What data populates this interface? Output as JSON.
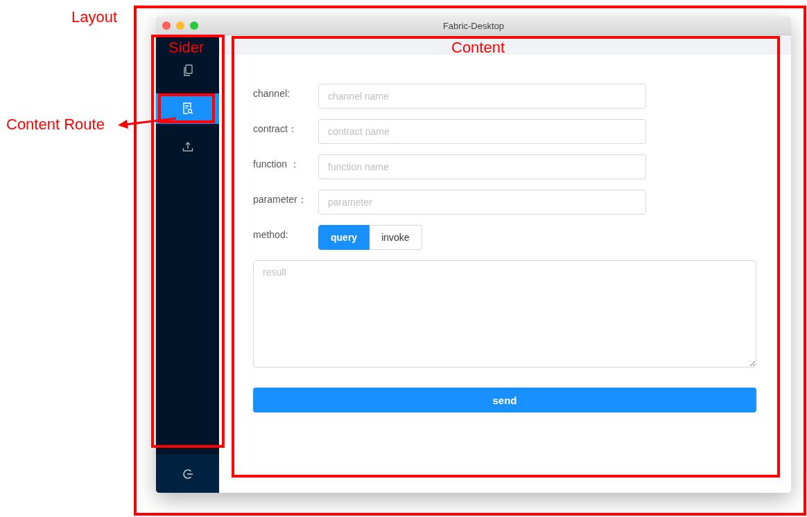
{
  "window": {
    "title": "Fabric-Desktop"
  },
  "sider": {
    "items": [
      {
        "kind": "copy",
        "selected": false
      },
      {
        "kind": "search-doc",
        "selected": true
      },
      {
        "kind": "upload",
        "selected": false
      }
    ],
    "footer": {
      "kind": "logout"
    }
  },
  "form": {
    "fields": [
      {
        "label": "channel:",
        "placeholder": "channel name"
      },
      {
        "label": "contract：",
        "placeholder": "contract name"
      },
      {
        "label": "function ：",
        "placeholder": "function name"
      },
      {
        "label": "parameter：",
        "placeholder": "parameter"
      }
    ],
    "method": {
      "label": "method:",
      "options": [
        {
          "label": "query",
          "selected": true
        },
        {
          "label": "invoke",
          "selected": false
        }
      ]
    },
    "result": {
      "placeholder": "result"
    },
    "send_button": "send"
  },
  "annotations": [
    {
      "label": "Layout"
    },
    {
      "label": "Sider"
    },
    {
      "label": "Content"
    },
    {
      "label": "Content Route"
    }
  ]
}
